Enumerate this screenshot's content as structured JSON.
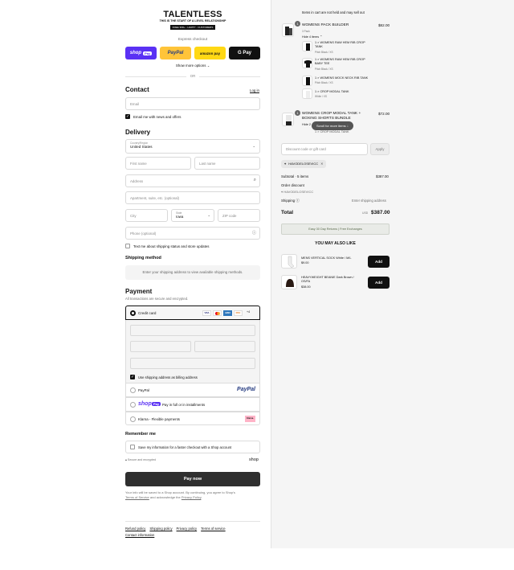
{
  "brand": {
    "name": "TALENTLESS",
    "tagline": "THIS IS THE START OF A LEVEL RELATIONSHIP",
    "promo": "FREE 30D+ - HAPPY - CUSTOMERS"
  },
  "express": {
    "title": "Express checkout",
    "shop_pay": "shop",
    "shop_pay_pill": "Pay",
    "paypal": "PayPal",
    "amazon": "amazon pay",
    "gpay": "G Pay",
    "more": "Show more options",
    "or": "OR"
  },
  "contact": {
    "title": "Contact",
    "login": "Log in",
    "email_placeholder": "Email",
    "news_label": "Email me with news and offers"
  },
  "delivery": {
    "title": "Delivery",
    "country_label": "Country/Region",
    "country_value": "United States",
    "first_name": "First name",
    "last_name": "Last name",
    "address": "Address",
    "apartment": "Apartment, suite, etc. (optional)",
    "city": "City",
    "state_label": "State",
    "state_value": "Iowa",
    "zip": "ZIP code",
    "phone": "Phone (optional)",
    "sms_label": "Text me about shipping status and store updates"
  },
  "shipping_method": {
    "title": "Shipping method",
    "note": "Enter your shipping address to view available shipping methods."
  },
  "payment": {
    "title": "Payment",
    "subtitle": "All transactions are secure and encrypted.",
    "credit_card": "Credit card",
    "card_brands": [
      "VISA",
      "MC",
      "AMEX",
      "DISC",
      "+4"
    ],
    "billing_label": "Use shipping address as billing address",
    "paypal": "PayPal",
    "paypal_logo": "PayPal",
    "shoppay_logo": "shop",
    "shoppay_pill": "Pay",
    "shoppay_text": "Pay in full or in installments",
    "klarna": "Klarna - Flexible payments",
    "klarna_logo": "Klarna."
  },
  "remember": {
    "title": "Remember me",
    "save_label": "Save my information for a faster checkout with a Shop account",
    "secure": "Secure and encrypted",
    "shop_logo": "shop"
  },
  "pay_button": "Pay now",
  "legal": {
    "line1": "Your info will be saved to a Shop account. By continuing, you agree to Shop's",
    "terms": "Terms of Service",
    "and": "and acknowledge the",
    "privacy": "Privacy Policy",
    "period": "."
  },
  "footer": {
    "links": [
      "Refund policy",
      "Shipping policy",
      "Privacy policy",
      "Terms of service"
    ],
    "contact": "Contact information"
  },
  "cart": {
    "notice": "Items in cart are not held and may sell out",
    "items": [
      {
        "qty": "1",
        "name": "WOMENS PACK BUILDER",
        "variant": "3 Pack",
        "toggle": "Hide 4 items",
        "price": "$82.00",
        "subitems": [
          {
            "name": "1 × WOMENS RAW HEM RIB CROP TANK",
            "variant": "Pitch Black / XS"
          },
          {
            "name": "1 × WOMENS RAW HEM RIB CROP BABY TEE",
            "variant": "Pitch Black / XS"
          },
          {
            "name": "1 × WOMENS MOCK NECK RIB TANK",
            "variant": "Pitch Black / XS"
          },
          {
            "name": "1 × CROP MODAL TANK",
            "variant": "White / XS"
          }
        ]
      },
      {
        "qty": "1",
        "name": "WOMENS CROP MODAL TANK + BOXING SHORTS BUNDLE",
        "toggle": "Hide 2",
        "price": "$72.00",
        "sub_peek": "1 × CROP MODAL TANK"
      }
    ],
    "scroll_hint": "Scroll for more items",
    "discount_placeholder": "Discount code or gift card",
    "apply": "Apply",
    "applied_code": "HAVODELOSEVICC",
    "subtotal_label": "Subtotal · 5 items",
    "subtotal_value": "$387.00",
    "order_discount": "Order discount",
    "order_discount_code": "HAVODELOSEVICC",
    "shipping_label": "Shipping",
    "shipping_value": "Enter shipping address",
    "total_label": "Total",
    "currency": "USD",
    "total_value": "$387.00",
    "returns_banner": "Easy 30 Day Returns | Free Exchanges"
  },
  "upsell": {
    "title": "YOU MAY ALSO LIKE",
    "items": [
      {
        "name": "MENS VERTICAL SOCK White / M/L",
        "price": "$9.00",
        "button": "Add"
      },
      {
        "name": "HEAVYWEIGHT BEANIE Dark Brown / OS/FA",
        "price": "$38.00",
        "button": "Add"
      }
    ]
  },
  "colors": {
    "shop_pay": "#5a31f4",
    "paypal_yellow": "#ffc439",
    "amazon_yellow": "#ffd814",
    "dark": "#111111",
    "panel": "#f5f5f5",
    "klarna_pink": "#ffb3c7",
    "returns_bg": "#e9ebe7"
  }
}
